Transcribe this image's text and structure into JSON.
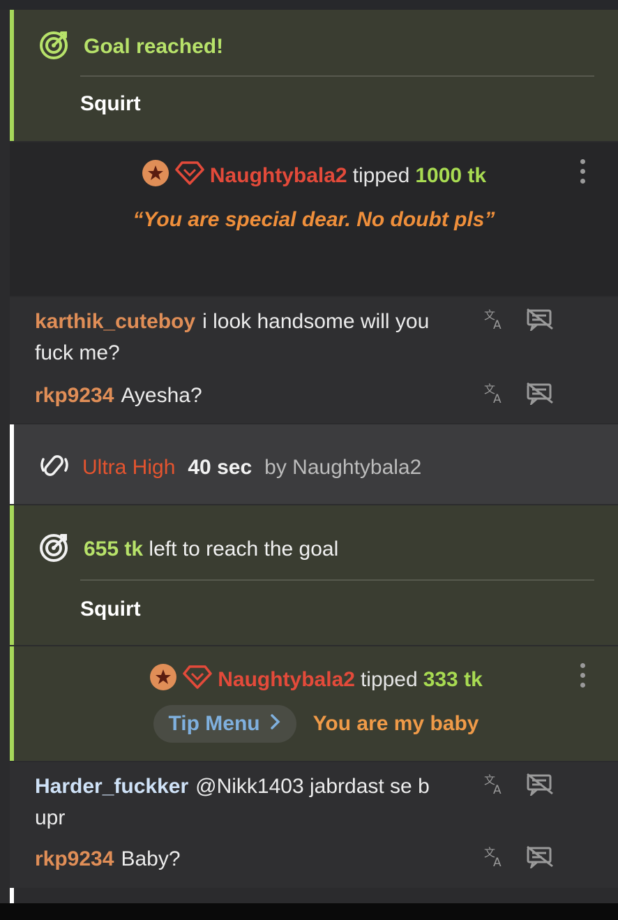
{
  "goal1": {
    "icon": "goal-target-icon",
    "title": "Goal reached!",
    "item": "Squirt"
  },
  "tip1": {
    "user": "Naughtybala2",
    "verb": "tipped",
    "amount": "1000 tk",
    "message": "“You are special dear. No doubt pls”"
  },
  "chat1": [
    {
      "user": "karthik_cuteboy",
      "text": "i look handsome will you fuck me?"
    },
    {
      "user": "rkp9234",
      "text": "Ayesha?"
    }
  ],
  "ultra": {
    "icon": "vibration-icon",
    "level": "Ultra High",
    "duration": "40 sec",
    "by": "by Naughtybala2"
  },
  "goal2": {
    "icon": "goal-target-icon",
    "amount": "655 tk",
    "text": "left to reach the goal",
    "item": "Squirt"
  },
  "tip2": {
    "user": "Naughtybala2",
    "verb": "tipped",
    "amount": "333 tk",
    "menu_label": "Tip Menu",
    "menu_item": "You are my baby"
  },
  "chat2": [
    {
      "user": "Harder_fuckker",
      "text": "@Nikk1403  jabrdast se b upr"
    },
    {
      "user": "rkp9234",
      "text": "Baby?"
    }
  ],
  "colors": {
    "goal_green": "#a6d75a",
    "username_red": "#e34a3a",
    "amount_green": "#a8db52",
    "quote_orange": "#ef8f3b",
    "ultra_red": "#e4542f",
    "tipmenu_blue": "#7fb0de"
  }
}
